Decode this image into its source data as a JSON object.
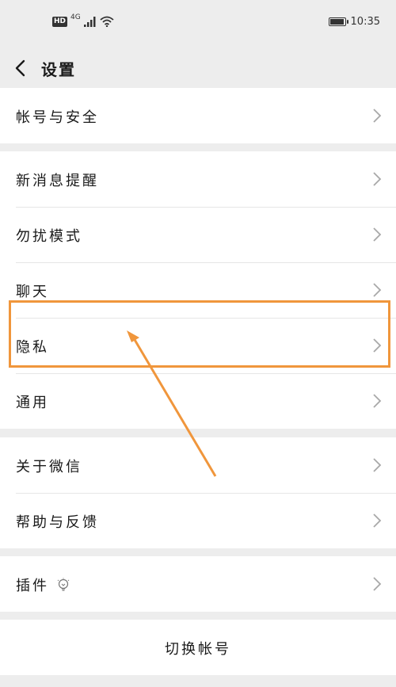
{
  "status_bar": {
    "hd_badge": "HD",
    "network": "4G",
    "time": "10:35",
    "battery_level": 0.85
  },
  "nav": {
    "title": "设置"
  },
  "groups": [
    {
      "items": [
        {
          "label": "帐号与安全"
        }
      ]
    },
    {
      "items": [
        {
          "label": "新消息提醒"
        },
        {
          "label": "勿扰模式"
        },
        {
          "label": "聊天"
        },
        {
          "label": "隐私"
        },
        {
          "label": "通用"
        }
      ]
    },
    {
      "items": [
        {
          "label": "关于微信"
        },
        {
          "label": "帮助与反馈"
        }
      ]
    },
    {
      "items": [
        {
          "label": "插件"
        }
      ]
    }
  ],
  "switch_account": "切换帐号",
  "colors": {
    "background": "#ededed",
    "card": "#ffffff",
    "annotation": "#f0963c"
  },
  "icons": {
    "back": "chevron-left-icon",
    "row": "chevron-right-icon",
    "plugin": "lightbulb-icon"
  }
}
